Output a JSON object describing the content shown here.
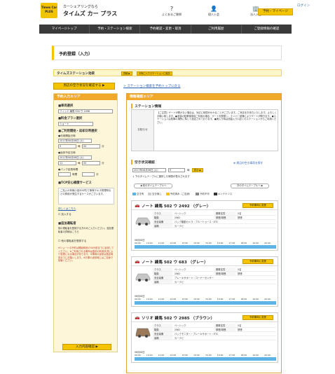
{
  "header": {
    "logo": "Times Car PLUS",
    "tagline": "カーシェアリングなら",
    "brand": "タイムズ カー プラス",
    "icons": [
      {
        "label": "よくあるご質問",
        "icon": "question-icon"
      },
      {
        "label": "個人入会",
        "icon": "person-icon"
      },
      {
        "label": "法人入会",
        "icon": "building-icon"
      }
    ],
    "mypage": "予約・マイページ",
    "login": "ログイン"
  },
  "nav": [
    "マイページトップ",
    "予約・ステーション検索",
    "予約確認・変更・取消",
    "ご利用履歴",
    "ご登録情報の確認"
  ],
  "page_title": "予約登録（入力）",
  "station": {
    "label": "タイムズステーション池袋",
    "tag1": "詳細 ▶",
    "tag2": "お気に入りステーションに追加"
  },
  "check_button": "周辺の空き状況を確認する ▶",
  "top_link": "> ステーション検索を予約トップに戻る",
  "left": {
    "header": "予約入力エリア",
    "vehicle_h": "■車両選択",
    "vehicle_val": "フィット 練馬 502 ウ 2496",
    "plan_h": "■料金プラン選択",
    "plan_val": "ショート",
    "period_h": "■ご利用開始・返却日時選択",
    "start_l": "●利用開始日時",
    "start_date": "2017年06月06日 (火)",
    "start_h": "9",
    "start_m": "00",
    "time_unit": "時",
    "minute_unit": "分",
    "end_l": "●返却予定日時",
    "end_date": "2017年06月06日 (火)",
    "end_h": "11",
    "end_m": "00",
    "pack_l": "●パック延長時間",
    "pack_a": "時間",
    "pack_b": "分",
    "tcp_h": "■TCP安心補償サービス",
    "tcp_note": "ご加入の有無(1回309円)で事故やキズ修理時などの費用が発生するケースがございます。",
    "tcp_link": "詳しくはこちら",
    "tcp_check": "加入する",
    "add_h": "■追加運転者",
    "add_note": "他の運転者を登録する方のみご入力ください。追加運転者の詳細はこちら",
    "add_check": "他の運転者を登録する",
    "notes": "※ショートの予約は開始時刻の30分前までに返却してください。※ご利用される車両は直前の利用状況により変更になる場合があります。※車両の返却は指定時刻までにお願いします。※お車の返却時にはご自身で保管ください。",
    "submit": "入力内容確認 ▶"
  },
  "right": {
    "header": "情報確認エリア",
    "station_h": "ステーション情報",
    "info_k": "お知らせ",
    "info_v": "【ご注意】ゲートが開かない場合は、対応に時間がかかることがございます。ご来店をお待ちいたします。よろしくお願い致します。●池袋の駐車場事前ご利用の場合：ゲートを開閉し、ナンバー認識によりゲートが開きます。●ステーションは駐車の場所に準じて設定されております。●満入り時は池袋入り口近くのステーションからご利用ください。",
    "check_h": "空き状況確認",
    "around": "周辺の空き車両を探す",
    "date": "2017年06月06日 (火)",
    "hour": "9",
    "display_btn": "表示 ▶",
    "hint": "↓ 下のタイムテーブルに選択した時間が表示されます",
    "prev": "前のタイムテーブルへ",
    "next": "次のタイムテーブルへ",
    "legend": [
      "空き有",
      "空き無し",
      "予約済み（ご自身）",
      "予約不可",
      "メンテナンス"
    ],
    "cars": [
      {
        "name": "ノート 練馬 502 ウ 2492 （グレー）",
        "cls": "ベーシック",
        "drive": "2WD",
        "equip": "バック駆動カメラ・ブルートゥース・ETC",
        "seats": "5名",
        "smoke": "禁煙",
        "nav": "カーナビ",
        "btn": "予約車両に変更",
        "date": "06月06日"
      },
      {
        "name": "ノート 練馬 502 ウ 683 （グレー）",
        "cls": "ベーシック",
        "drive": "2WD",
        "equip": "ブレーキサポート・コーナーセンサー",
        "seats": "5名",
        "smoke": "禁煙",
        "nav": "カーナビ",
        "btn": "予約車両に変更",
        "date": "06月06日"
      },
      {
        "name": "ソリオ 練馬 502 ウ 2985 （ブラウン）",
        "cls": "ベーシック",
        "drive": "2WD",
        "equip": "バックモニター・ブレーキサポート・ETC",
        "seats": "5名",
        "smoke": "禁煙",
        "nav": "カーナビ",
        "btn": "予約車両に変更",
        "date": "06月06日"
      }
    ],
    "spec_labels": {
      "cls": "クラス",
      "drive": "駆動",
      "equip": "安全装備",
      "seats": "乗車定員",
      "smoke": "禁煙/喫煙",
      "nav": "装備"
    },
    "hours": [
      "09:00",
      "10:00",
      "11:00",
      "12:00",
      "13:00",
      "14:00",
      "15:00",
      "16:00",
      "17:00",
      "18:00",
      "19:00",
      "20:00"
    ]
  },
  "colors": {
    "accent": "#f4c400",
    "nav": "#3a3a3a",
    "orange": "#f0a92a",
    "available": "#5db3e6"
  }
}
